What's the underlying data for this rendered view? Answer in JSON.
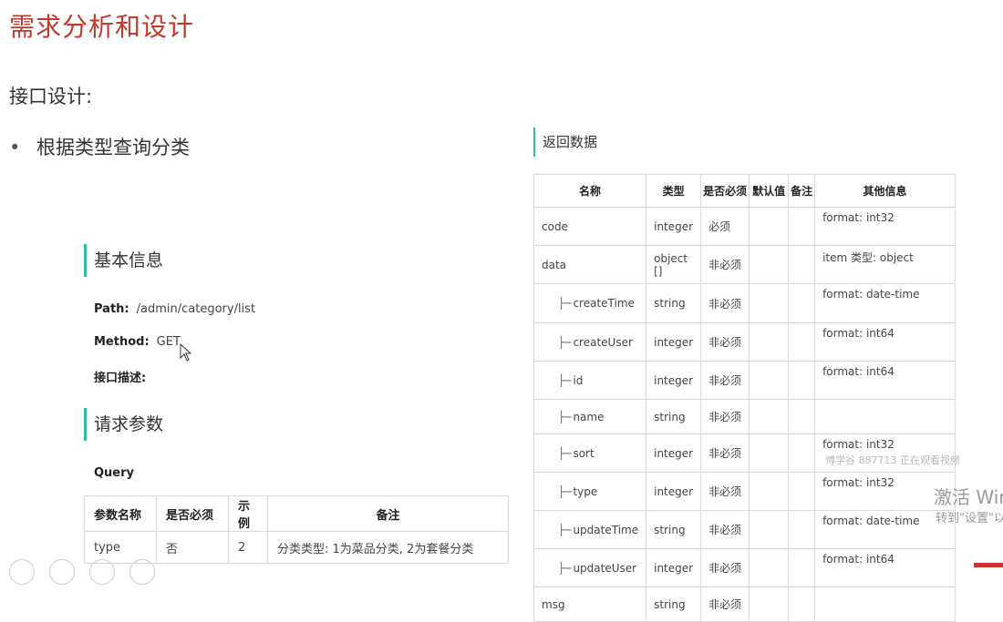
{
  "slide": {
    "title": "需求分析和设计",
    "subtitle": "接口设计:",
    "bullet": "根据类型查询分类"
  },
  "basic": {
    "heading": "基本信息",
    "path_label": "Path:",
    "path_value": "/admin/category/list",
    "method_label": "Method:",
    "method_value": "GET",
    "desc_label": "接口描述:"
  },
  "request": {
    "heading": "请求参数",
    "query_label": "Query",
    "columns": [
      "参数名称",
      "是否必须",
      "示例",
      "备注"
    ],
    "rows": [
      [
        "type",
        "否",
        "2",
        "分类类型: 1为菜品分类, 2为套餐分类"
      ]
    ]
  },
  "response": {
    "heading": "返回数据",
    "columns": [
      "名称",
      "类型",
      "是否必须",
      "默认值",
      "备注",
      "其他信息"
    ],
    "rows": [
      {
        "name": "code",
        "child": false,
        "type": "integer",
        "required": "必须",
        "default": "",
        "note": "",
        "info": "format: int32"
      },
      {
        "name": "data",
        "child": false,
        "type": "object []",
        "required": "非必须",
        "default": "",
        "note": "",
        "info": "item 类型: object"
      },
      {
        "name": "createTime",
        "child": true,
        "type": "string",
        "required": "非必须",
        "default": "",
        "note": "",
        "info": "format: date-time"
      },
      {
        "name": "createUser",
        "child": true,
        "type": "integer",
        "required": "非必须",
        "default": "",
        "note": "",
        "info": "format: int64"
      },
      {
        "name": "id",
        "child": true,
        "type": "integer",
        "required": "非必须",
        "default": "",
        "note": "",
        "info": "format: int64"
      },
      {
        "name": "name",
        "child": true,
        "type": "string",
        "required": "非必须",
        "default": "",
        "note": "",
        "info": ""
      },
      {
        "name": "sort",
        "child": true,
        "type": "integer",
        "required": "非必须",
        "default": "",
        "note": "",
        "info": "format: int32"
      },
      {
        "name": "type",
        "child": true,
        "type": "integer",
        "required": "非必须",
        "default": "",
        "note": "",
        "info": "format: int32"
      },
      {
        "name": "updateTime",
        "child": true,
        "type": "string",
        "required": "非必须",
        "default": "",
        "note": "",
        "info": "format: date-time"
      },
      {
        "name": "updateUser",
        "child": true,
        "type": "integer",
        "required": "非必须",
        "default": "",
        "note": "",
        "info": "format: int64"
      },
      {
        "name": "msg",
        "child": false,
        "type": "string",
        "required": "非必须",
        "default": "",
        "note": "",
        "info": ""
      }
    ]
  },
  "tree_glyph": "├─",
  "overlay": {
    "watermark_small": "博学谷 887713 正在观看视频",
    "activate_line1": "激活 Wir",
    "activate_line2": "转到\"设置\"以"
  },
  "colors": {
    "title": "#c0392b",
    "accent": "#2bbf9a"
  }
}
